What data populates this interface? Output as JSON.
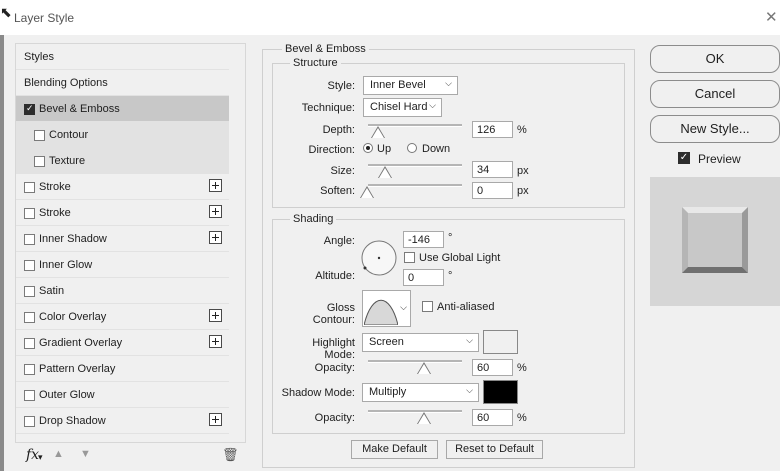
{
  "window": {
    "title": "Layer Style"
  },
  "sidebar": {
    "items": [
      {
        "label": "Styles"
      },
      {
        "label": "Blending Options"
      },
      {
        "label": "Bevel & Emboss"
      },
      {
        "label": "Contour"
      },
      {
        "label": "Texture"
      },
      {
        "label": "Stroke"
      },
      {
        "label": "Stroke"
      },
      {
        "label": "Inner Shadow"
      },
      {
        "label": "Inner Glow"
      },
      {
        "label": "Satin"
      },
      {
        "label": "Color Overlay"
      },
      {
        "label": "Gradient Overlay"
      },
      {
        "label": "Pattern Overlay"
      },
      {
        "label": "Outer Glow"
      },
      {
        "label": "Drop Shadow"
      }
    ],
    "fx_label": "fx"
  },
  "bevel": {
    "group_title": "Bevel & Emboss",
    "structure": {
      "title": "Structure",
      "style_label": "Style:",
      "style_value": "Inner Bevel",
      "technique_label": "Technique:",
      "technique_value": "Chisel Hard",
      "depth_label": "Depth:",
      "depth_value": "126",
      "depth_unit": "%",
      "direction_label": "Direction:",
      "direction_up": "Up",
      "direction_down": "Down",
      "size_label": "Size:",
      "size_value": "34",
      "size_unit": "px",
      "soften_label": "Soften:",
      "soften_value": "0",
      "soften_unit": "px"
    },
    "shading": {
      "title": "Shading",
      "angle_label": "Angle:",
      "angle_value": "-146",
      "angle_unit": "°",
      "global_light_label": "Use Global Light",
      "altitude_label": "Altitude:",
      "altitude_value": "0",
      "altitude_unit": "°",
      "gloss_label": "Gloss Contour:",
      "antialiased_label": "Anti-aliased",
      "highlight_label": "Highlight Mode:",
      "highlight_value": "Screen",
      "highlight_color": "#ffffff",
      "highlight_opacity_label": "Opacity:",
      "highlight_opacity": "60",
      "highlight_opacity_unit": "%",
      "shadow_label": "Shadow Mode:",
      "shadow_value": "Multiply",
      "shadow_color": "#000000",
      "shadow_opacity_label": "Opacity:",
      "shadow_opacity": "60",
      "shadow_opacity_unit": "%"
    },
    "make_default": "Make Default",
    "reset_default": "Reset to Default"
  },
  "actions": {
    "ok": "OK",
    "cancel": "Cancel",
    "new_style": "New Style...",
    "preview_label": "Preview"
  }
}
